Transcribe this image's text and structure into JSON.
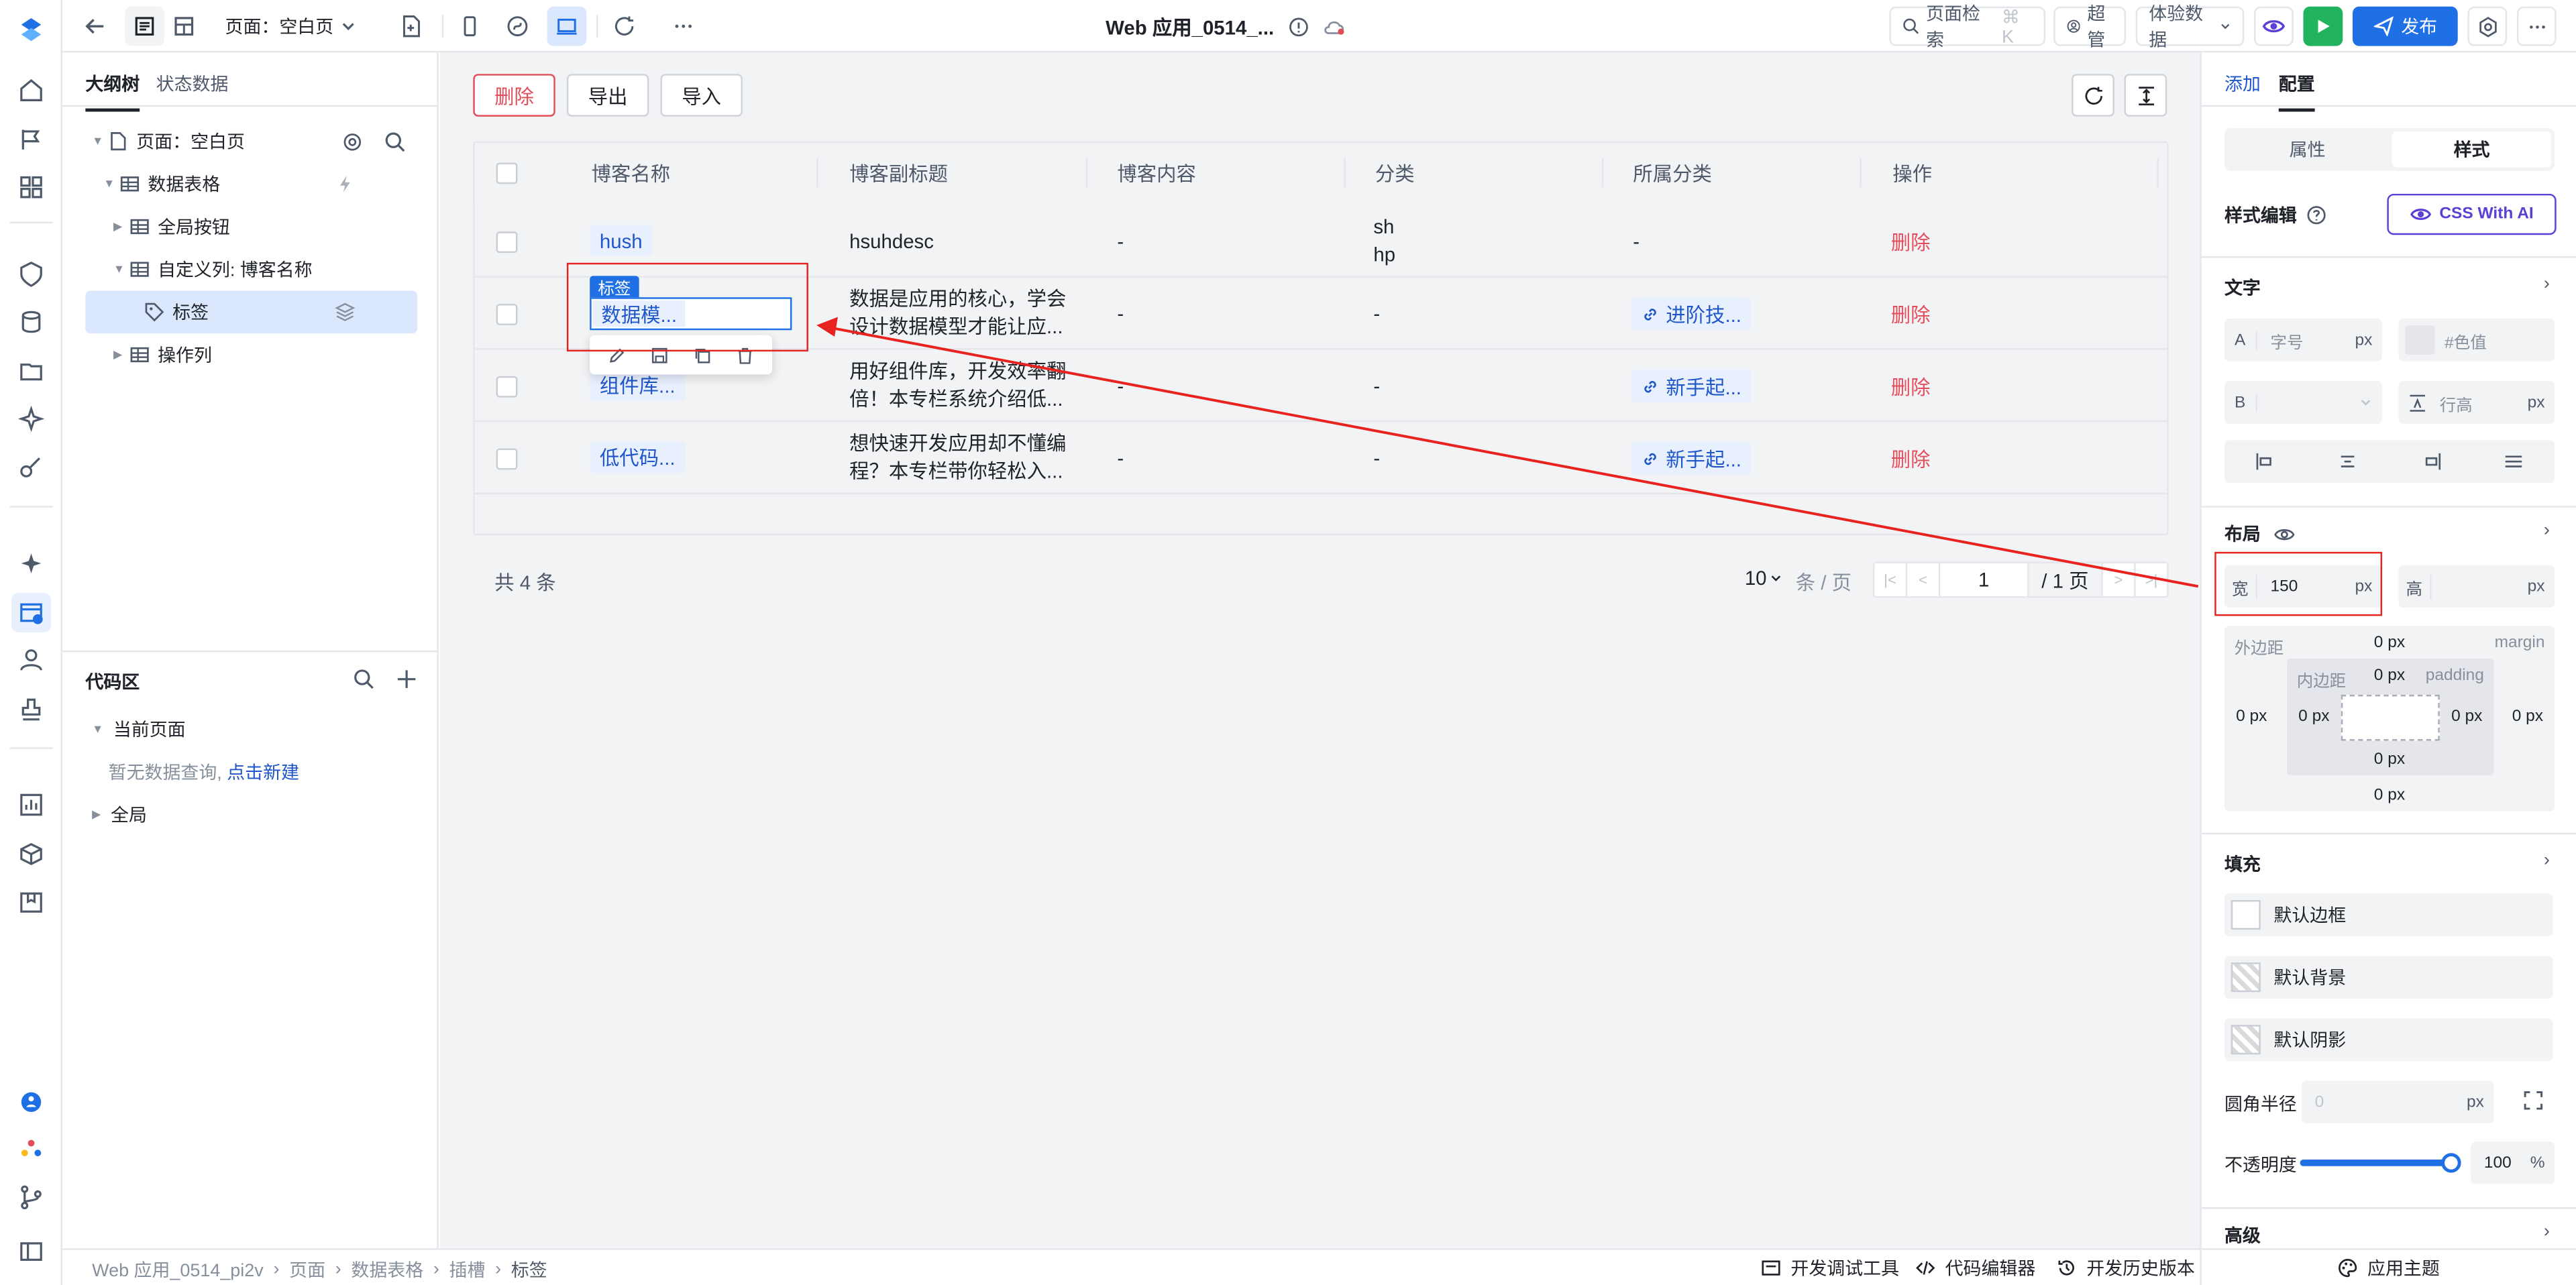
{
  "colors": {
    "accent": "#1f6fe5",
    "danger": "#e34d59",
    "annotation": "#e8231f",
    "run": "#22b35e"
  },
  "topbar": {
    "page_selector": "页面：空白页",
    "title": "Web 应用_0514_...",
    "search_label": "页面检索",
    "search_shortcut": "⌘ K",
    "user_label": "超管",
    "data_env": "体验数据",
    "publish_label": "发布"
  },
  "left_panel": {
    "tabs": [
      "大纲树",
      "状态数据"
    ],
    "tree": [
      {
        "label": "页面：空白页",
        "icon": "page-icon"
      },
      {
        "label": "数据表格",
        "icon": "table-icon"
      },
      {
        "label": "全局按钮",
        "icon": "table-icon"
      },
      {
        "label": "自定义列: 博客名称",
        "icon": "table-icon"
      },
      {
        "label": "标签",
        "icon": "tag-icon"
      },
      {
        "label": "操作列",
        "icon": "table-icon"
      }
    ],
    "code_area": {
      "title": "代码区",
      "current_page": "当前页面",
      "empty_text": "暂无数据查询,",
      "create_link": "点击新建",
      "global": "全局"
    }
  },
  "toolbar": {
    "delete": "删除",
    "export": "导出",
    "import": "导入"
  },
  "table": {
    "columns": [
      "博客名称",
      "博客副标题",
      "博客内容",
      "分类",
      "所属分类",
      "操作"
    ],
    "rows": [
      {
        "name": "hush",
        "subtitle": [
          "hsuhdesc",
          ""
        ],
        "content": "-",
        "category": [
          "sh",
          "hp"
        ],
        "belong": "-",
        "action": "删除"
      },
      {
        "name": "数据模...",
        "subtitle": [
          "数据是应用的核心，学会",
          "设计数据模型才能让应..."
        ],
        "content": "-",
        "category": [
          "-",
          ""
        ],
        "belong": "进阶技...",
        "action": "删除"
      },
      {
        "name": "组件库...",
        "subtitle": [
          "用好组件库，开发效率翻",
          "倍！本专栏系统介绍低..."
        ],
        "content": "-",
        "category": [
          "-",
          ""
        ],
        "belong": "新手起...",
        "action": "删除"
      },
      {
        "name": "低代码...",
        "subtitle": [
          "想快速开发应用却不懂编",
          "程？本专栏带你轻松入..."
        ],
        "content": "-",
        "category": [
          "-",
          ""
        ],
        "belong": "新手起...",
        "action": "删除"
      }
    ],
    "selected_tag_label": "标签"
  },
  "pagination": {
    "total": "共 4 条",
    "page_size": "10",
    "per_page": "条 / 页",
    "current": "1",
    "total_pages": "/ 1 页"
  },
  "right_panel": {
    "tabs": [
      "添加",
      "配置"
    ],
    "seg": [
      "属性",
      "样式"
    ],
    "style_edit": "样式编辑",
    "css_ai": "CSS With AI",
    "text_section": "文字",
    "font_size_ph": "字号",
    "color_ph": "#色值",
    "line_height_ph": "行高",
    "unit": "px",
    "label_a": "A",
    "label_b": "B",
    "layout_section": "布局",
    "width_label": "宽",
    "width_value": "150",
    "height_label": "高",
    "margin_label": "外边距",
    "margin_en": "margin",
    "padding_label": "内边距",
    "padding_en": "padding",
    "box_value": "0 px",
    "fill_section": "填充",
    "border": "默认边框",
    "background": "默认背景",
    "shadow": "默认阴影",
    "radius_label": "圆角半径",
    "radius_ph": "0",
    "opacity_label": "不透明度",
    "opacity_value": "100",
    "opacity_fraction": 1.0,
    "percent": "%",
    "advanced": "高级"
  },
  "bottom": {
    "breadcrumb": [
      "Web 应用_0514_pi2v",
      "页面",
      "数据表格",
      "插槽",
      "标签"
    ],
    "tools": [
      "开发调试工具",
      "代码编辑器",
      "开发历史版本",
      "应用主题"
    ]
  }
}
